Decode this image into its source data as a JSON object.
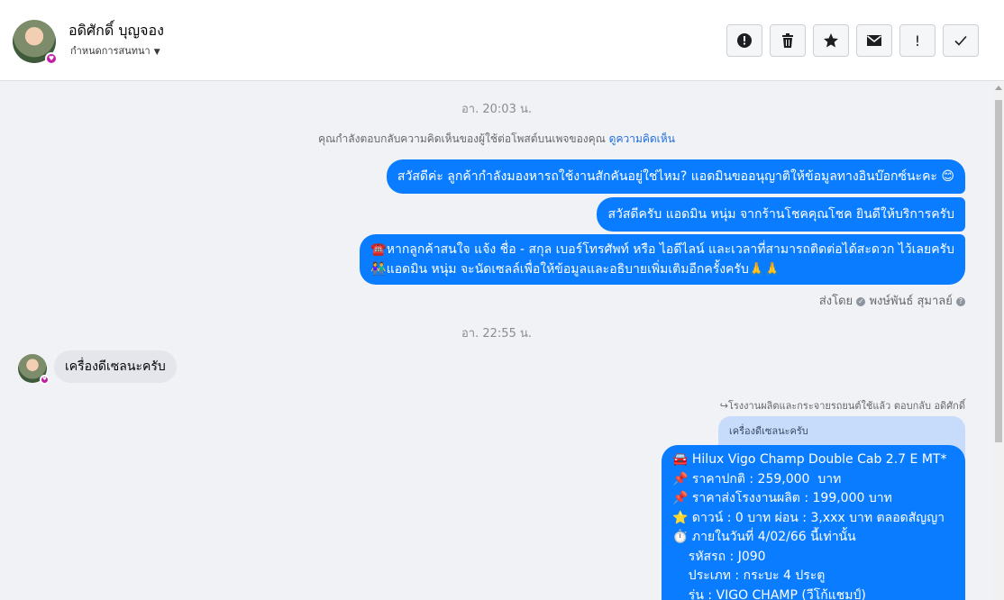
{
  "header": {
    "name": "อดิศักดิ์ บุญจอง",
    "subtitle": "กำหนดการสนทนา",
    "tools": [
      {
        "icon": "alert-circle-icon"
      },
      {
        "icon": "trash-icon"
      },
      {
        "icon": "star-icon"
      },
      {
        "icon": "envelope-icon"
      },
      {
        "icon": "exclamation-icon",
        "label": "!"
      },
      {
        "icon": "checkmark-icon"
      }
    ]
  },
  "chat": {
    "time1": "อา. 20:03 น.",
    "notice_text": "คุณกำลังตอบกลับความคิดเห็นของผู้ใช้ต่อโพสต์บนเพจของคุณ",
    "notice_link": "ดูความคิดเห็น",
    "out_msg1": "สวัสดีค่ะ ลูกค้ากำลังมองหารถใช้งานสักคันอยู่ใช่ไหม? แอดมินขออนุญาติให้ข้อมูลทางอินบ๊อกซ์นะคะ 😊",
    "out_msg2": "สวัสดีครับ แอดมิน หนุ่ม จากร้านโชคคุณโชค ยินดีให้บริการครับ",
    "out_msg3_line1": "☎️หากลูกค้าสนใจ แจ้ง ชื่อ - สกุล เบอร์โทรศัพท์ หรือ ไอดีไลน์ และเวลาที่สามารถติดต่อได้สะดวก ไว้เลยครับ",
    "out_msg3_line2": "👫แอดมิน หนุ่ม จะนัดเซลล์เพื่อให้ข้อมูลและอธิบายเพิ่มเติมอีกครั้งครับ🙏🙏",
    "sent_by_label": "ส่งโดย",
    "sent_by_name": "พงษ์พันธ์ สุมาลย์",
    "time2": "อา. 22:55 น.",
    "in_msg": "เครื่องดีเซลนะครับ",
    "reply_ref": "โรงงานผลิตและกระจายรถยนต์ใช้แล้ว ตอบกลับ อดิศักดิ์",
    "quoted_text": "เครื่องดีเซลนะครับ",
    "car_lines": [
      "🚘 Hilux Vigo Champ Double Cab 2.7 E MT*",
      "📌 ราคาปกติ : 259,000  บาท",
      "📌 ราคาส่งโรงงานผลิต : 199,000 บาท",
      "⭐ ดาวน์ : 0 บาท ผ่อน : 3,xxx บาท ตลอดสัญญา",
      "⏱️ ภายในวันที่ 4/02/66 นี้เท่านั้น",
      "    รหัสรถ : J090",
      "    ประเภท : กระบะ 4 ประตู",
      "    รุ่น : VIGO CHAMP (วีโก้แชมป์)"
    ]
  }
}
